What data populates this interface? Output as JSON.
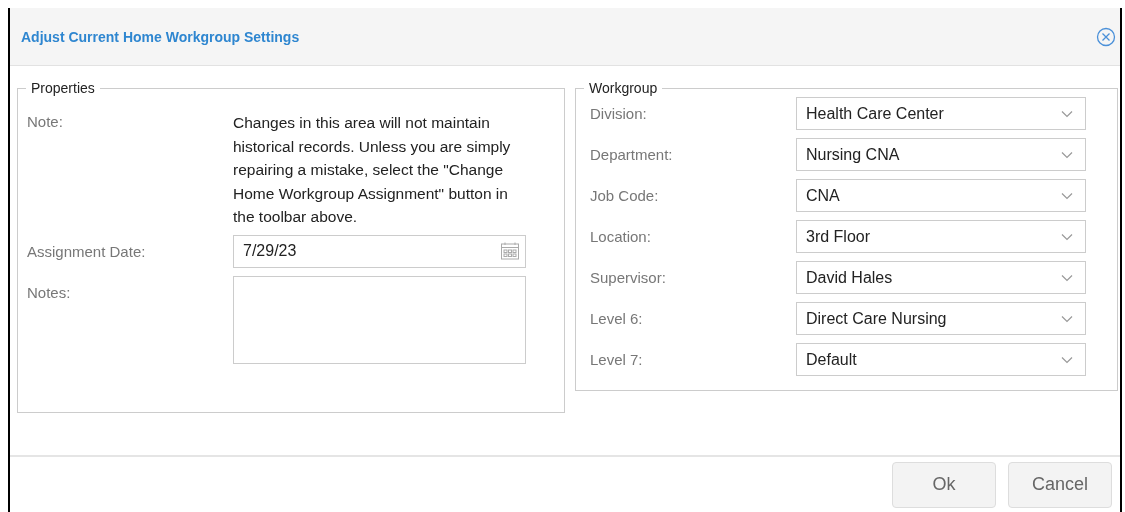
{
  "dialog": {
    "title": "Adjust Current Home Workgroup Settings"
  },
  "properties": {
    "legend": "Properties",
    "note_label": "Note:",
    "note": "Changes in this area will not maintain historical records. Unless you are simply repairing a mistake, select the \"Change Home Workgroup Assignment\" button in the toolbar above.",
    "date_label": "Assignment Date:",
    "date_value": "7/29/23",
    "notes_label": "Notes:"
  },
  "workgroup": {
    "legend": "Workgroup",
    "fields": [
      {
        "label": "Division:",
        "value": "Health Care Center"
      },
      {
        "label": "Department:",
        "value": "Nursing CNA"
      },
      {
        "label": "Job Code:",
        "value": "CNA"
      },
      {
        "label": "Location:",
        "value": "3rd Floor"
      },
      {
        "label": "Supervisor:",
        "value": "David Hales"
      },
      {
        "label": "Level 6:",
        "value": "Direct Care Nursing"
      },
      {
        "label": "Level 7:",
        "value": "Default"
      }
    ]
  },
  "buttons": [
    "Ok",
    "Cancel"
  ]
}
